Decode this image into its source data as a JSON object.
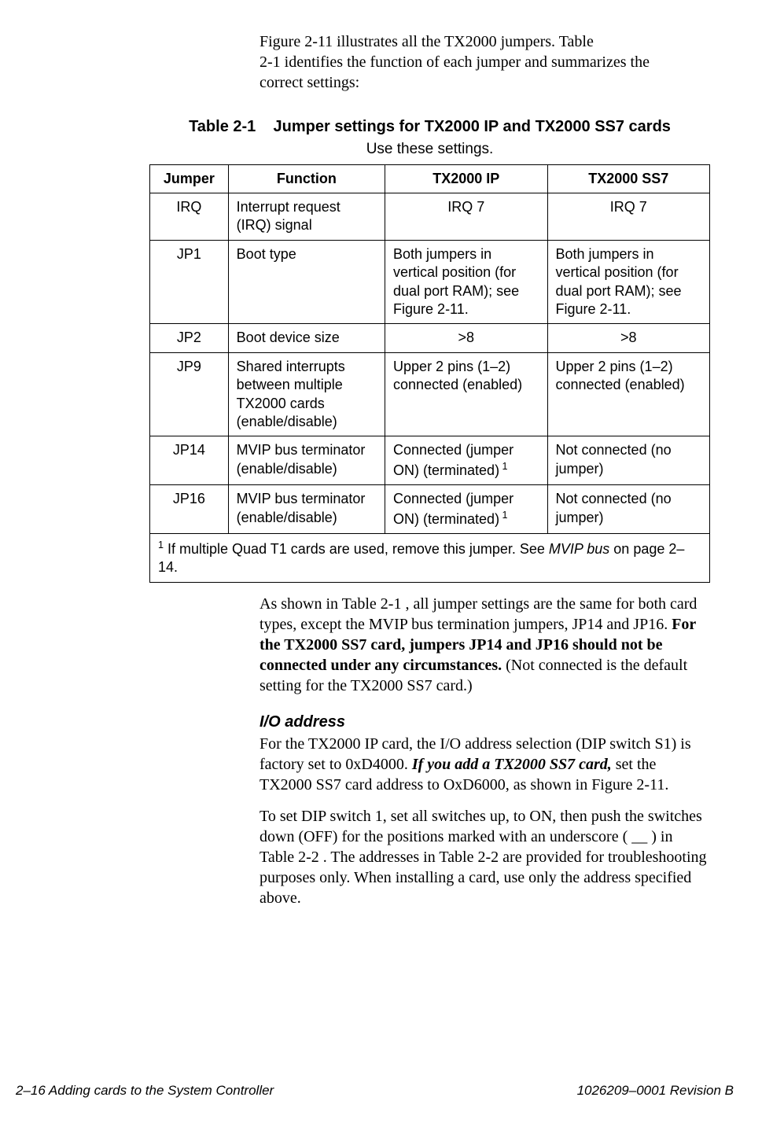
{
  "intro": {
    "line1": "Figure 2-11 illustrates all the TX2000 jumpers. Table",
    "line2": "2-1 identifies the function of each jumper and summarizes the",
    "line3": "correct settings:"
  },
  "table": {
    "caption_prefix": "Table  2-1",
    "caption_title": "Jumper settings for TX2000 IP and TX2000 SS7 cards",
    "subcaption": "Use these settings.",
    "headers": [
      "Jumper",
      "Function",
      "TX2000 IP",
      "TX2000 SS7"
    ],
    "rows": [
      {
        "jumper": "IRQ",
        "function": "Interrupt request (IRQ) signal",
        "ip": "IRQ 7",
        "ss7": "IRQ 7",
        "ip_center": true,
        "ss7_center": true
      },
      {
        "jumper": "JP1",
        "function": "Boot type",
        "ip": "Both jumpers in vertical position (for dual port RAM); see Figure 2-11.",
        "ss7": "Both jumpers in vertical position (for dual port RAM); see Figure 2-11."
      },
      {
        "jumper": "JP2",
        "function": "Boot device size",
        "ip": ">8",
        "ss7": ">8",
        "ip_center": true,
        "ss7_center": true
      },
      {
        "jumper": "JP9",
        "function": "Shared interrupts between multiple TX2000 cards (enable/disable)",
        "ip": "Upper 2 pins (1–2) connected (enabled)",
        "ss7": "Upper 2 pins (1–2) connected (enabled)"
      },
      {
        "jumper": "JP14",
        "function": "MVIP bus terminator (enable/disable)",
        "ip": "Connected (jumper ON) (terminated)",
        "ip_sup": "1",
        "ss7": "Not connected (no jumper)"
      },
      {
        "jumper": "JP16",
        "function": "MVIP bus terminator (enable/disable)",
        "ip": "Connected (jumper ON) (terminated)",
        "ip_sup": "1",
        "ss7": "Not connected (no jumper)"
      }
    ],
    "footnote_sup": "1",
    "footnote_pre": " If multiple Quad T1 cards are used, remove this jumper. See ",
    "footnote_italic": "MVIP bus",
    "footnote_post": " on page 2–14."
  },
  "post_table": {
    "p1_a": "As shown in Table 2-1 , all jumper settings are the same for both card types, except the MVIP bus termination jumpers, JP14 and JP16. ",
    "p1_bold": "For the TX2000 SS7 card, jumpers JP14 and JP16 should not be connected under any circumstances.",
    "p1_b": " (Not connected is the default setting for the TX2000 SS7 card.)"
  },
  "io": {
    "heading": "I/O address",
    "p1_a": "For the TX2000 IP card, the I/O address selection (DIP switch S1) is factory set to 0xD4000. ",
    "p1_bolditalic": "If you add a TX2000 SS7 card,",
    "p1_b": " set the TX2000 SS7 card address to OxD6000, as shown in Figure 2-11.",
    "p2": "To set DIP switch 1, set all switches up, to ON, then push the switches down (OFF) for the positions marked with an underscore ( __ ) in Table 2-2 . The addresses in Table 2-2 are provided for troubleshooting purposes only. When installing a card, use only the address specified above."
  },
  "footer": {
    "left": "2–16  Adding cards to the System Controller",
    "right": "1026209–0001  Revision B"
  }
}
